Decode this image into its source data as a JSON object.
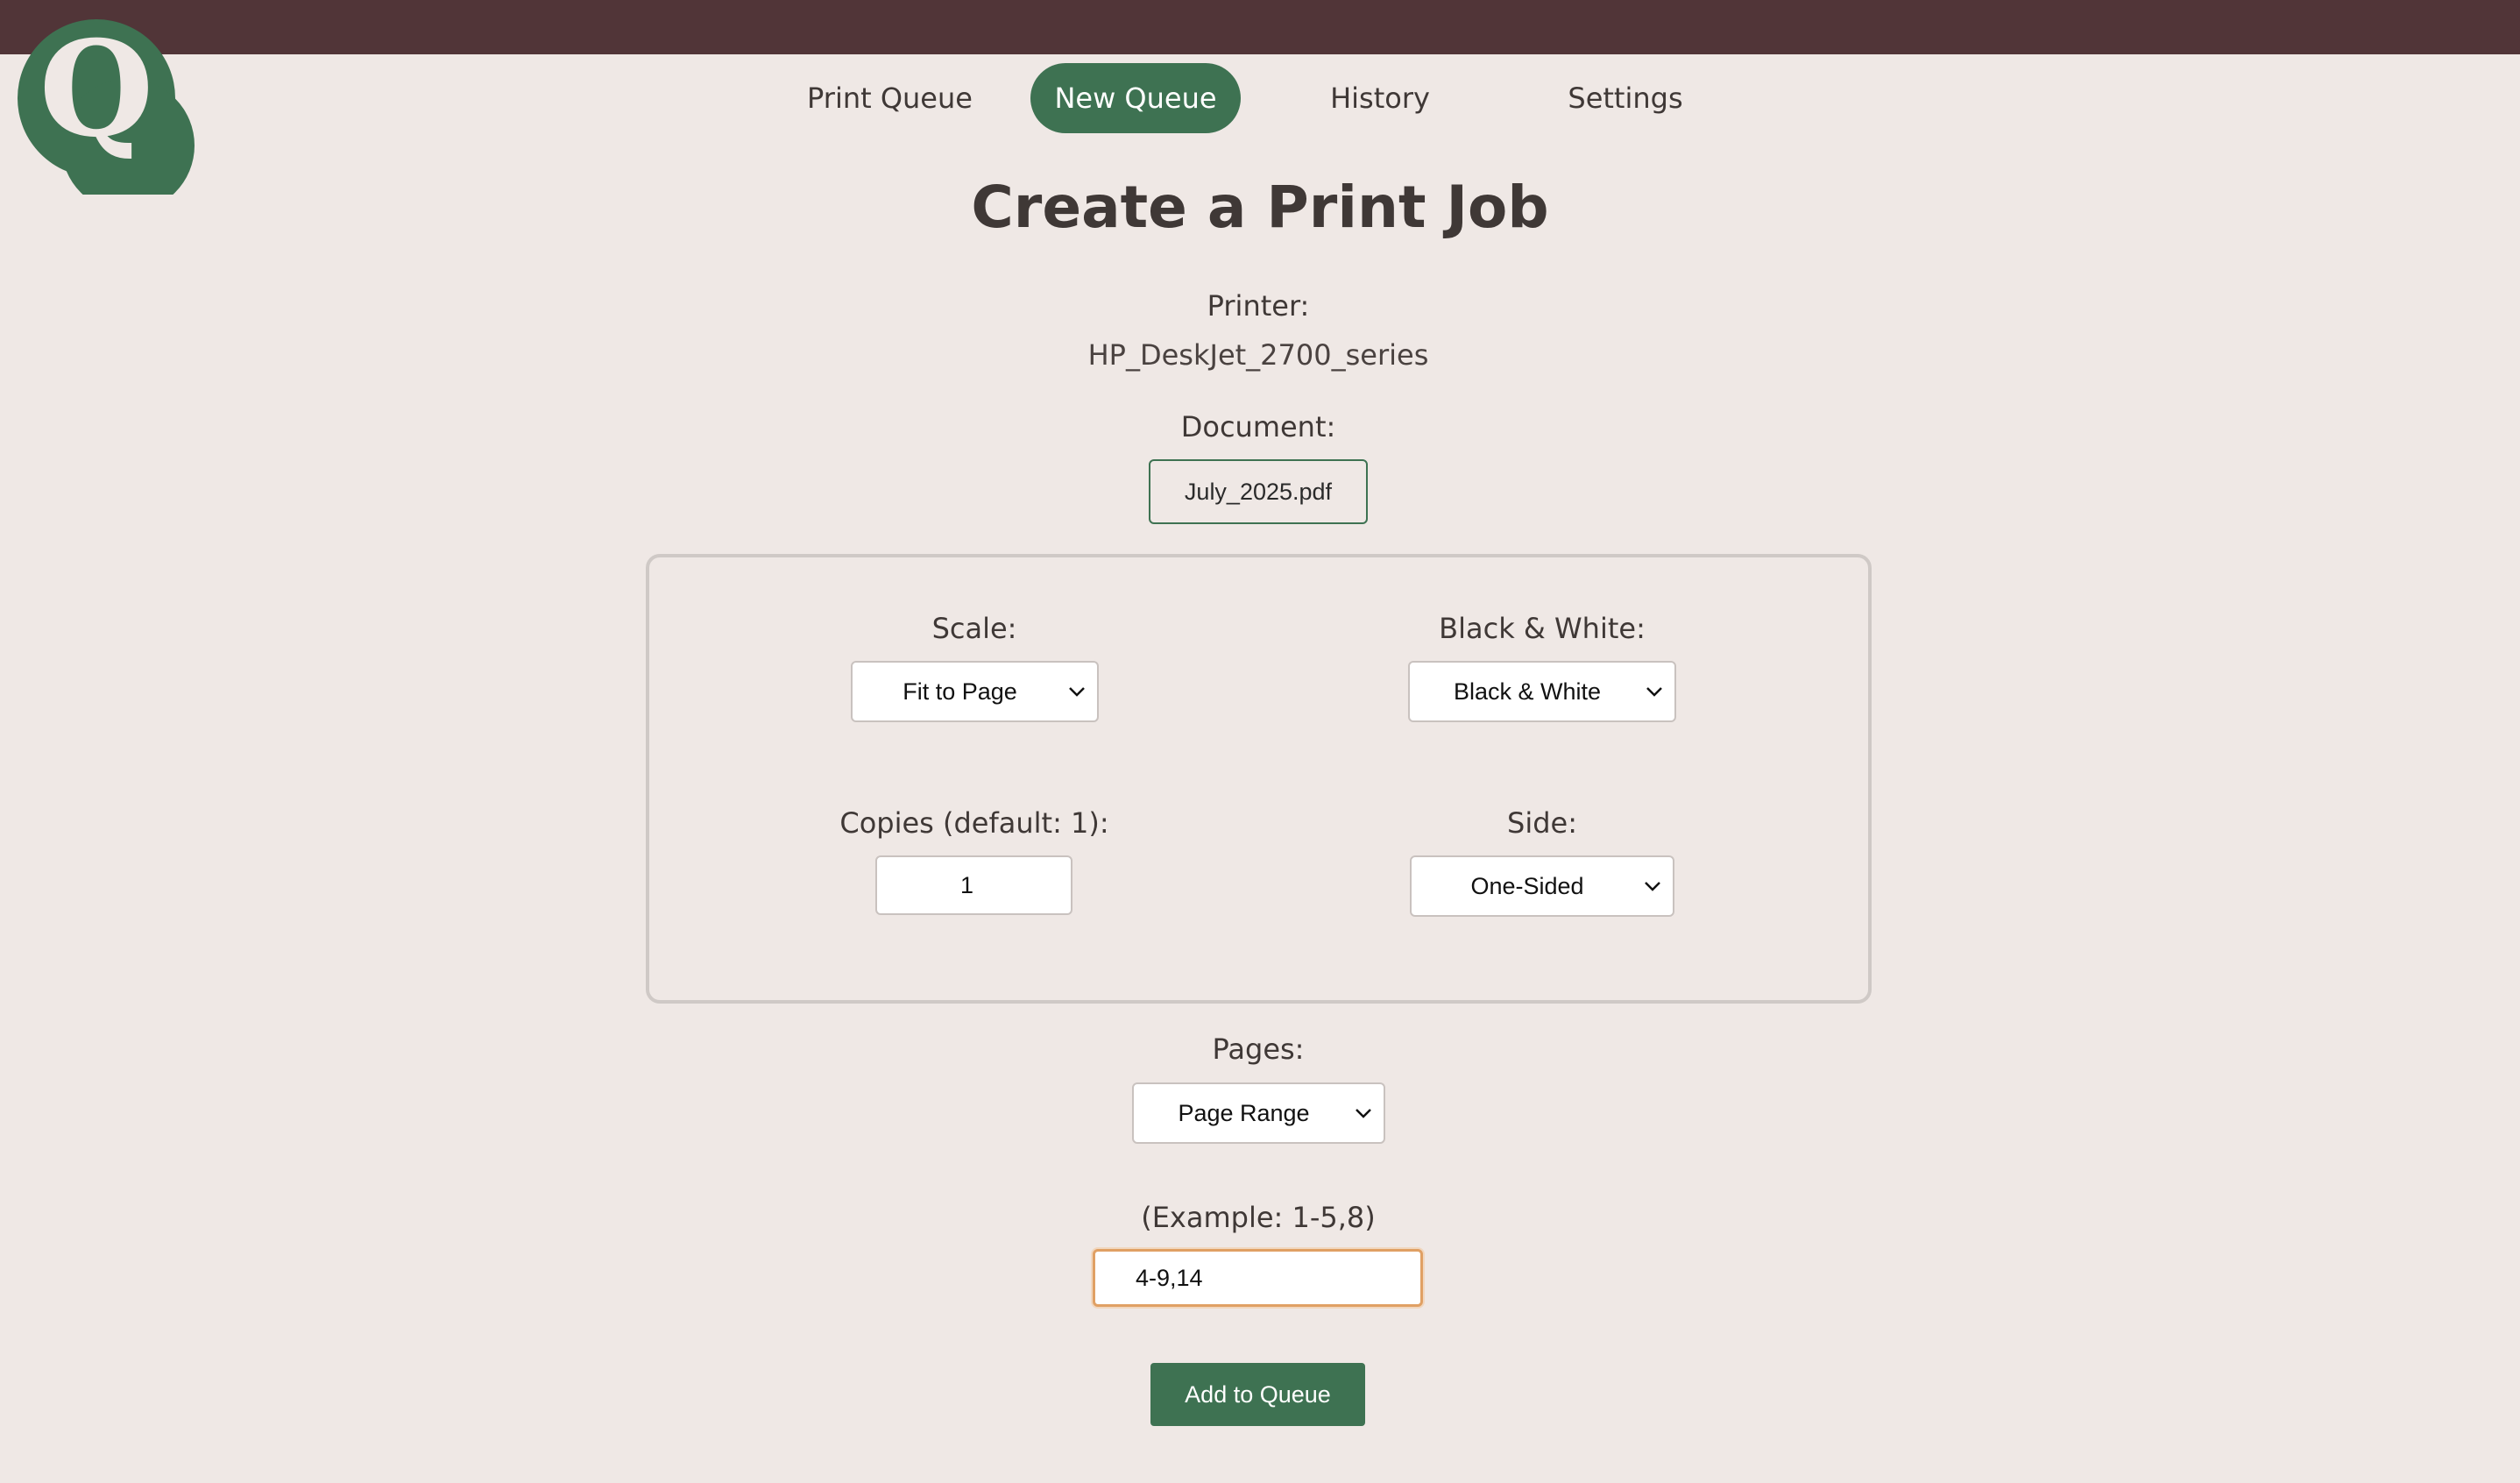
{
  "brand": {
    "logo_letter": "Q",
    "topbar_color": "#513538",
    "accent_color": "#3e7252"
  },
  "nav": {
    "items": [
      {
        "label": "Print Queue",
        "active": false
      },
      {
        "label": "New Queue",
        "active": true
      },
      {
        "label": "History",
        "active": false
      },
      {
        "label": "Settings",
        "active": false
      }
    ]
  },
  "page": {
    "title": "Create a Print Job"
  },
  "printer": {
    "label": "Printer:",
    "value": "HP_DeskJet_2700_series"
  },
  "document": {
    "label": "Document:",
    "file_name": "July_2025.pdf"
  },
  "options": {
    "scale": {
      "label": "Scale:",
      "selected": "Fit to Page"
    },
    "color": {
      "label": "Black & White:",
      "selected": "Black & White"
    },
    "copies": {
      "label": "Copies (default: 1):",
      "value": "1"
    },
    "side": {
      "label": "Side:",
      "selected": "One-Sided"
    }
  },
  "pages": {
    "label": "Pages:",
    "selected": "Page Range",
    "example_label": "(Example: 1-5,8)",
    "range_value": "4-9,14"
  },
  "actions": {
    "submit_label": "Add to Queue"
  }
}
